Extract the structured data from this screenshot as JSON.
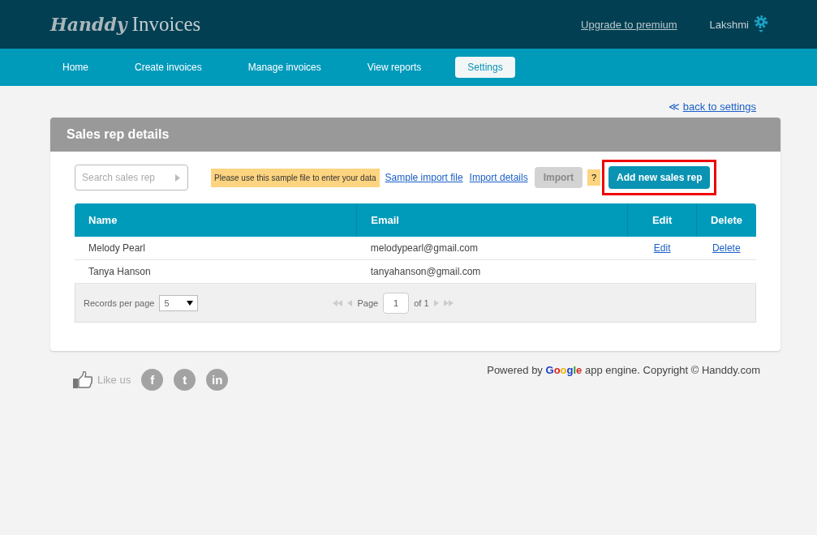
{
  "header": {
    "logo_script": "Handdy",
    "logo_text": "Invoices",
    "upgrade_link": "Upgrade to premium",
    "user": "Lakshmi"
  },
  "nav": [
    {
      "label": "Home",
      "selected": false
    },
    {
      "label": "Create invoices",
      "selected": false
    },
    {
      "label": "Manage invoices",
      "selected": false
    },
    {
      "label": "View reports",
      "selected": false
    },
    {
      "label": "Settings",
      "selected": true
    }
  ],
  "back_link": {
    "arrow": "≪",
    "label": "back to settings"
  },
  "panel": {
    "title": "Sales rep details",
    "search": {
      "placeholder": "Search sales rep"
    },
    "hint": "Please use this sample file to enter your data",
    "links": [
      "Sample import file",
      "Import details"
    ],
    "import_button": {
      "label": "Import",
      "disabled": true
    },
    "help": "?",
    "add_button": {
      "label": "Add new sales rep",
      "highlighted": true
    },
    "table": {
      "columns": [
        "Name",
        "Email",
        "Edit",
        "Delete"
      ],
      "rows": [
        {
          "name": "Melody Pearl",
          "email": "melodypearl@gmail.com",
          "edit": "Edit",
          "delete": "Delete"
        },
        {
          "name": "Tanya Hanson",
          "email": "tanyahanson@gmail.com"
        }
      ],
      "pager": {
        "records_label": "Records per page",
        "records_value": "5",
        "page_label": "Page",
        "page": "1",
        "of": "of 1"
      }
    }
  },
  "footer": {
    "like": "Like us",
    "social": [
      "f",
      "t",
      "in"
    ],
    "powered_prefix": "Powered by",
    "google": "Google",
    "powered_suffix": "app engine. Copyright © Handdy.com"
  }
}
